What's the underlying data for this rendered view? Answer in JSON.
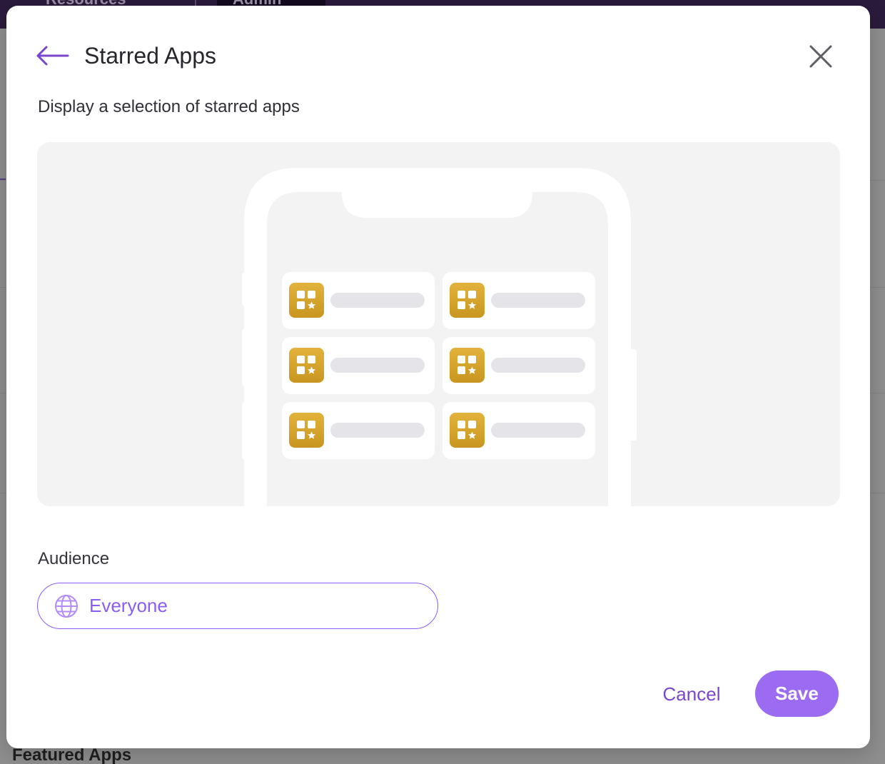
{
  "background": {
    "tabs": [
      "Resources",
      "Admin"
    ],
    "section_title": "Featured Apps"
  },
  "modal": {
    "title": "Starred Apps",
    "back_icon": "arrow-left-icon",
    "close_icon": "close-icon",
    "subtitle": "Display a selection of starred apps",
    "preview": {
      "illustration": "phone-with-starred-apps-grid",
      "tile_icon": "starred-app-icon",
      "tile_count": 6
    },
    "audience": {
      "label": "Audience",
      "value": "Everyone",
      "icon": "globe-icon"
    },
    "actions": {
      "cancel_label": "Cancel",
      "save_label": "Save"
    }
  },
  "colors": {
    "accent": "#8b5cf6",
    "save_button": "#9b6bf2",
    "app_icon_top": "#e2b33c",
    "app_icon_bottom": "#c8961f",
    "preview_bg": "#f3f3f4"
  }
}
